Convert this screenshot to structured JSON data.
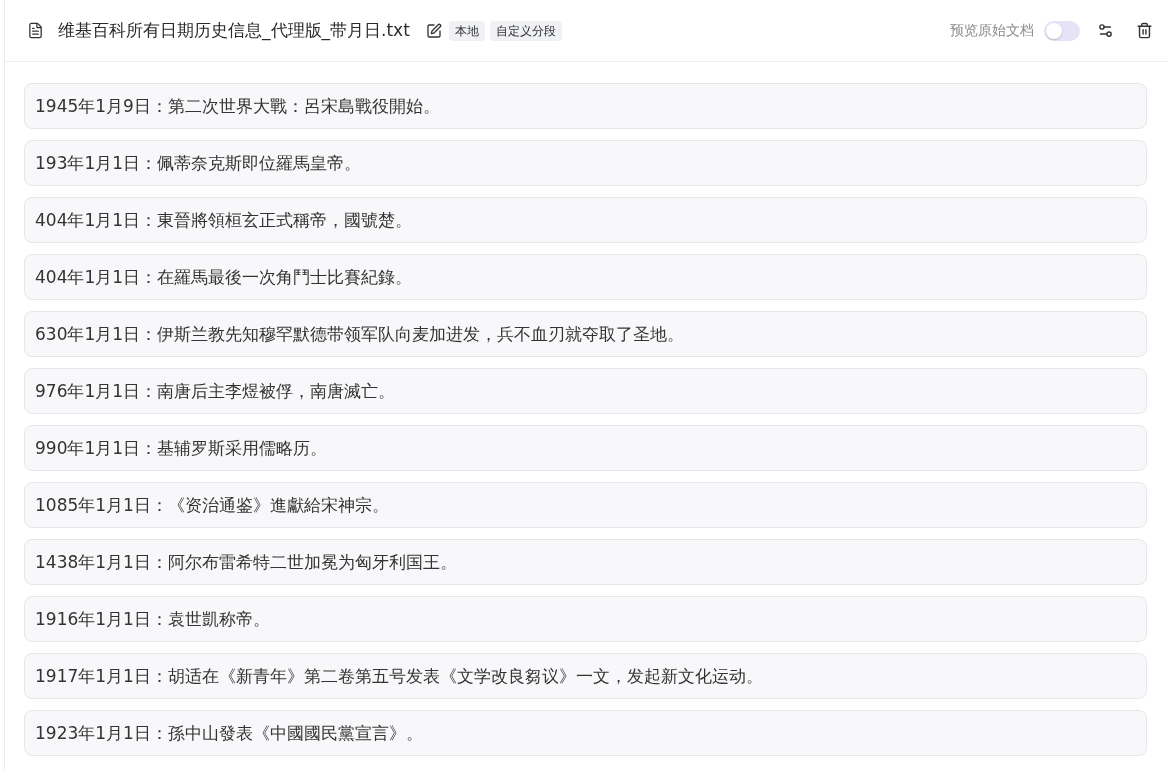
{
  "file": {
    "title": "维基百科所有日期历史信息_代理版_带月日.txt",
    "tags": [
      "本地",
      "自定义分段"
    ]
  },
  "preview": {
    "label": "预览原始文档",
    "on": false
  },
  "rows": [
    {
      "text": "1945年1月9日：第二次世界大戰：呂宋島戰役開始。"
    },
    {
      "text": "193年1月1日：佩蒂奈克斯即位羅馬皇帝。"
    },
    {
      "text": "404年1月1日：東晉將領桓玄正式稱帝，國號楚。"
    },
    {
      "text": "404年1月1日：在羅馬最後一次角鬥士比賽紀錄。"
    },
    {
      "text": "630年1月1日：伊斯兰教先知穆罕默德带领军队向麦加进发，兵不血刃就夺取了圣地。"
    },
    {
      "text": "976年1月1日：南唐后主李煜被俘，南唐滅亡。"
    },
    {
      "text": "990年1月1日：基辅罗斯采用儒略历。"
    },
    {
      "text": "1085年1月1日：《资治通鉴》進獻給宋神宗。"
    },
    {
      "text": "1438年1月1日：阿尔布雷希特二世加冕为匈牙利国王。"
    },
    {
      "text": "1916年1月1日：袁世凱称帝。"
    },
    {
      "text": "1917年1月1日：胡适在《新青年》第二卷第五号发表《文学改良芻议》一文，发起新文化运动。"
    },
    {
      "text": "1923年1月1日：孫中山發表《中國國民黨宣言》。"
    }
  ]
}
